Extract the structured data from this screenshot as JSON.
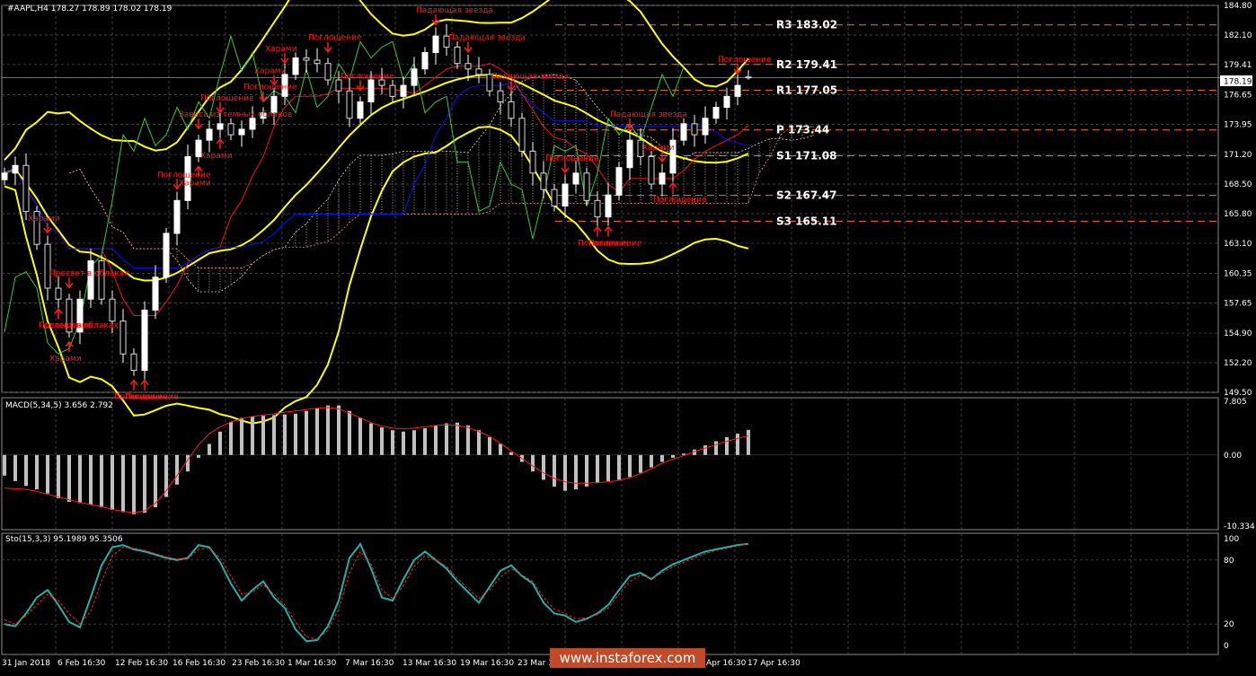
{
  "chart_header": {
    "symbol_line": "#AAPL,H4  178.27 178.89 178.02 178.19",
    "current_price": "178.19"
  },
  "colors": {
    "background": "#000000",
    "grid": "#5a5a5a",
    "bull_candle": "#ffffff",
    "bear_candle": "#d8d8d8",
    "bollinger": "#ffff00",
    "pivot_lines": "#ff6a3d",
    "tenkan": "#ff1010",
    "kijun": "#1010ff",
    "chikou": "#32cd32",
    "pattern_label": "#ff1a1a",
    "macd_hist": "#c0c0c0",
    "macd_signal": "#ff1a1a",
    "sto_main": "#20b2aa",
    "sto_signal": "#ff2020"
  },
  "watermark": "www.instaforex.com",
  "pivots": [
    {
      "label": "R3",
      "value": "183.02",
      "text": "R3  183.02"
    },
    {
      "label": "R2",
      "value": "179.41",
      "text": "R2  179.41"
    },
    {
      "label": "R1",
      "value": "177.05",
      "text": "R1  177.05"
    },
    {
      "label": "P",
      "value": "173.44",
      "text": "P  173.44"
    },
    {
      "label": "S1",
      "value": "171.08",
      "text": "S1  171.08"
    },
    {
      "label": "S2",
      "value": "167.47",
      "text": "S2  167.47"
    },
    {
      "label": "S3",
      "value": "165.11",
      "text": "S3  165.11"
    }
  ],
  "patterns": [
    {
      "text": "Харами"
    },
    {
      "text": "Поглощение"
    },
    {
      "text": "Просвет в облаках"
    },
    {
      "text": "Просвет в облаках"
    },
    {
      "text": "Харами"
    },
    {
      "text": "Поглощение"
    },
    {
      "text": "Поглощение"
    },
    {
      "text": "Завеса из темных облаков"
    },
    {
      "text": "Поглощение"
    },
    {
      "text": "Харами"
    },
    {
      "text": "Харами"
    },
    {
      "text": "Поглощение"
    },
    {
      "text": "Поглощение"
    },
    {
      "text": "Харами"
    },
    {
      "text": "Харами"
    },
    {
      "text": "Поглощение"
    },
    {
      "text": "Поглощение"
    },
    {
      "text": "Падающая звезда"
    },
    {
      "text": "Падающая звезда"
    },
    {
      "text": "Падающая звезда"
    },
    {
      "text": "Поглощение"
    },
    {
      "text": "Поглощение"
    },
    {
      "text": "Падающая звезда"
    },
    {
      "text": "Харами"
    },
    {
      "text": "Поглощение"
    },
    {
      "text": "Поглощение"
    },
    {
      "text": "Поглощение"
    }
  ],
  "chart_data": [
    {
      "type": "candlestick",
      "title": "#AAPL,H4",
      "header": "#AAPL,H4  178.27 178.89 178.02 178.19",
      "ylim": [
        149.5,
        184.8
      ],
      "price_ticks": [
        "184.80",
        "182.10",
        "179.41",
        "176.65",
        "173.95",
        "171.20",
        "168.50",
        "165.80",
        "163.10",
        "160.35",
        "157.65",
        "154.90",
        "152.20",
        "149.50"
      ],
      "x_tick_labels": [
        "31 Jan 2018",
        "6 Feb 16:30",
        "12 Feb 16:30",
        "16 Feb 16:30",
        "23 Feb 16:30",
        "1 Mar 16:30",
        "7 Mar 16:30",
        "13 Mar 16:30",
        "19 Mar 16:30",
        "23 Mar 16:30",
        "",
        "",
        "",
        "17 Apr 16:30"
      ],
      "x_ticks_partial": [
        "Apr 16:30"
      ],
      "last": {
        "open": 178.27,
        "high": 178.89,
        "low": 178.02,
        "close": 178.19
      },
      "close_path": [
        169.5,
        170.2,
        166.0,
        163.0,
        159.0,
        158.0,
        155.0,
        158.0,
        161.5,
        158.0,
        156.0,
        153.0,
        151.5,
        157.0,
        160.0,
        164.0,
        167.0,
        171.0,
        172.5,
        173.5,
        174.0,
        173.0,
        173.5,
        174.5,
        175.0,
        176.5,
        178.5,
        180.0,
        179.8,
        179.5,
        178.0,
        177.0,
        174.5,
        176.0,
        178.0,
        177.5,
        176.5,
        177.5,
        179.0,
        180.5,
        182.0,
        181.0,
        179.5,
        179.0,
        178.5,
        177.0,
        176.0,
        174.5,
        171.5,
        169.5,
        168.0,
        166.5,
        168.5,
        169.5,
        167.0,
        165.5,
        167.5,
        170.0,
        172.5,
        171.0,
        168.5,
        169.5,
        172.5,
        174.0,
        173.0,
        174.5,
        175.5,
        176.5,
        177.5,
        178.19
      ],
      "series": [
        {
          "name": "Bollinger Bands",
          "type": "line"
        },
        {
          "name": "Ichimoku",
          "type": "cloud"
        }
      ]
    },
    {
      "type": "bar",
      "title": "MACD(5,34,5) 3.656 2.792",
      "params": "5,34,5",
      "main_value": 3.656,
      "signal_value": 2.792,
      "ylim": [
        -10.334,
        7.805
      ],
      "y_ticks": [
        "7.805",
        "0.00",
        "-10.334"
      ],
      "hist": [
        -3.0,
        -3.8,
        -4.5,
        -5.0,
        -5.6,
        -6.3,
        -6.8,
        -7.0,
        -7.2,
        -7.6,
        -8.0,
        -8.3,
        -8.6,
        -8.4,
        -7.6,
        -6.1,
        -4.3,
        -2.4,
        -0.4,
        1.6,
        3.4,
        4.8,
        5.4,
        5.6,
        5.7,
        5.8,
        5.9,
        6.0,
        6.4,
        6.8,
        7.2,
        7.2,
        6.4,
        5.4,
        4.6,
        4.0,
        3.6,
        3.4,
        3.6,
        3.9,
        4.3,
        4.6,
        4.7,
        4.3,
        3.6,
        2.6,
        1.6,
        0.4,
        -1.0,
        -2.4,
        -3.6,
        -4.6,
        -5.2,
        -5.0,
        -4.6,
        -4.1,
        -3.8,
        -3.6,
        -3.2,
        -2.6,
        -1.8,
        -1.0,
        -0.4,
        0.2,
        0.8,
        1.4,
        2.0,
        2.6,
        3.1,
        3.656
      ],
      "signal": [
        -4.8,
        -4.9,
        -5.0,
        -5.3,
        -5.7,
        -6.1,
        -6.5,
        -6.9,
        -7.2,
        -7.5,
        -7.9,
        -8.2,
        -8.4,
        -8.1,
        -7.0,
        -5.2,
        -3.0,
        -0.7,
        1.5,
        3.1,
        4.1,
        4.8,
        5.3,
        5.6,
        5.8,
        6.0,
        6.2,
        6.4,
        6.6,
        6.8,
        6.9,
        6.7,
        6.1,
        5.4,
        4.7,
        4.2,
        3.9,
        3.8,
        3.9,
        4.1,
        4.3,
        4.4,
        4.3,
        4.0,
        3.4,
        2.7,
        1.7,
        0.6,
        -0.5,
        -1.6,
        -2.6,
        -3.4,
        -3.9,
        -4.1,
        -4.1,
        -4.0,
        -3.9,
        -3.7,
        -3.3,
        -2.7,
        -2.0,
        -1.2,
        -0.6,
        -0.1,
        0.5,
        1.0,
        1.5,
        2.0,
        2.4,
        2.792
      ]
    },
    {
      "type": "line",
      "title": "Sto(15,3,3) 95.1989 95.3506",
      "params": "15,3,3",
      "main_value": 95.1989,
      "signal_value": 95.3506,
      "ylim": [
        0,
        100
      ],
      "y_ticks": [
        "100",
        "80",
        "20",
        "0"
      ],
      "series": [
        {
          "name": "main",
          "values": [
            20,
            18,
            30,
            45,
            52,
            38,
            22,
            17,
            45,
            75,
            92,
            94,
            90,
            88,
            85,
            82,
            80,
            82,
            94,
            92,
            78,
            58,
            42,
            52,
            60,
            45,
            35,
            15,
            4,
            5,
            18,
            42,
            82,
            95,
            72,
            45,
            42,
            62,
            80,
            88,
            80,
            72,
            60,
            50,
            40,
            55,
            70,
            75,
            65,
            58,
            40,
            30,
            28,
            22,
            25,
            30,
            38,
            52,
            65,
            68,
            62,
            70,
            76,
            80,
            84,
            88,
            90,
            92,
            94,
            95.1989
          ]
        },
        {
          "name": "signal",
          "values": [
            24,
            20,
            28,
            38,
            48,
            42,
            30,
            20,
            32,
            60,
            84,
            92,
            91,
            89,
            86,
            83,
            81,
            81,
            90,
            91,
            82,
            65,
            48,
            50,
            57,
            48,
            38,
            22,
            8,
            6,
            14,
            34,
            68,
            88,
            76,
            52,
            44,
            56,
            74,
            84,
            80,
            74,
            63,
            53,
            44,
            52,
            64,
            72,
            66,
            60,
            45,
            34,
            30,
            25,
            26,
            29,
            35,
            48,
            60,
            66,
            63,
            68,
            74,
            78,
            82,
            86,
            89,
            91,
            93,
            95.3506
          ]
        }
      ]
    }
  ]
}
